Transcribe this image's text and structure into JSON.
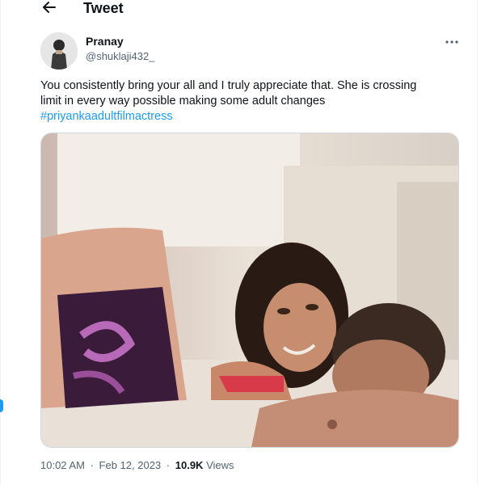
{
  "header": {
    "title": "Tweet",
    "back_icon": "arrow-left-icon"
  },
  "tweet": {
    "author": {
      "display_name": "Pranay",
      "handle": "@shuklaji432_"
    },
    "more_icon": "ellipsis-icon",
    "text_line1": "You consistently bring your all and I truly appreciate that. She is crossing",
    "text_line2": "limit in every way possible making some adult changes",
    "hashtag": "#priyankaadultfilmactress",
    "time": "10:02 AM",
    "date": "Feb 12, 2023",
    "views_count": "10.9K",
    "views_label": "Views",
    "dot": "·"
  },
  "colors": {
    "accent": "#1d9bf0",
    "text": "#0f1419",
    "secondary": "#536471",
    "border": "#cfd9de"
  }
}
